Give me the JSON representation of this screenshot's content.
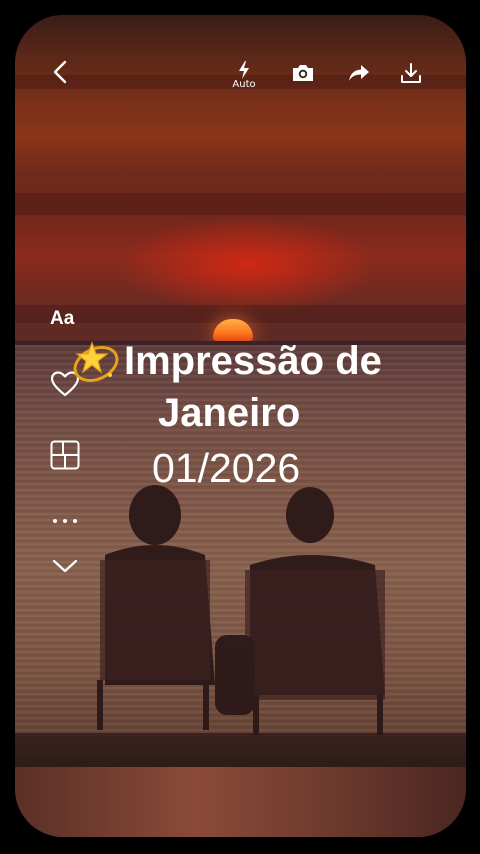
{
  "toolbar": {
    "flash_label": "Auto"
  },
  "side_tools": {
    "text_tool_label": "Aa"
  },
  "caption": {
    "line1": "Impressão de",
    "line2": "Janeiro",
    "date": "01/2026"
  },
  "icons": {
    "back": "chevron-left-icon",
    "flash": "flash-icon",
    "camera": "camera-icon",
    "share": "share-icon",
    "download": "download-icon",
    "favorite": "heart-icon",
    "layout": "layout-grid-icon",
    "more": "more-dots-icon",
    "collapse": "chevron-down-icon",
    "sparkle": "dizzy-star-emoji"
  },
  "colors": {
    "sky_red": "#8a2a1c",
    "sun": "#ff7a20",
    "sea": "#7b5548",
    "text": "#ffffff"
  }
}
